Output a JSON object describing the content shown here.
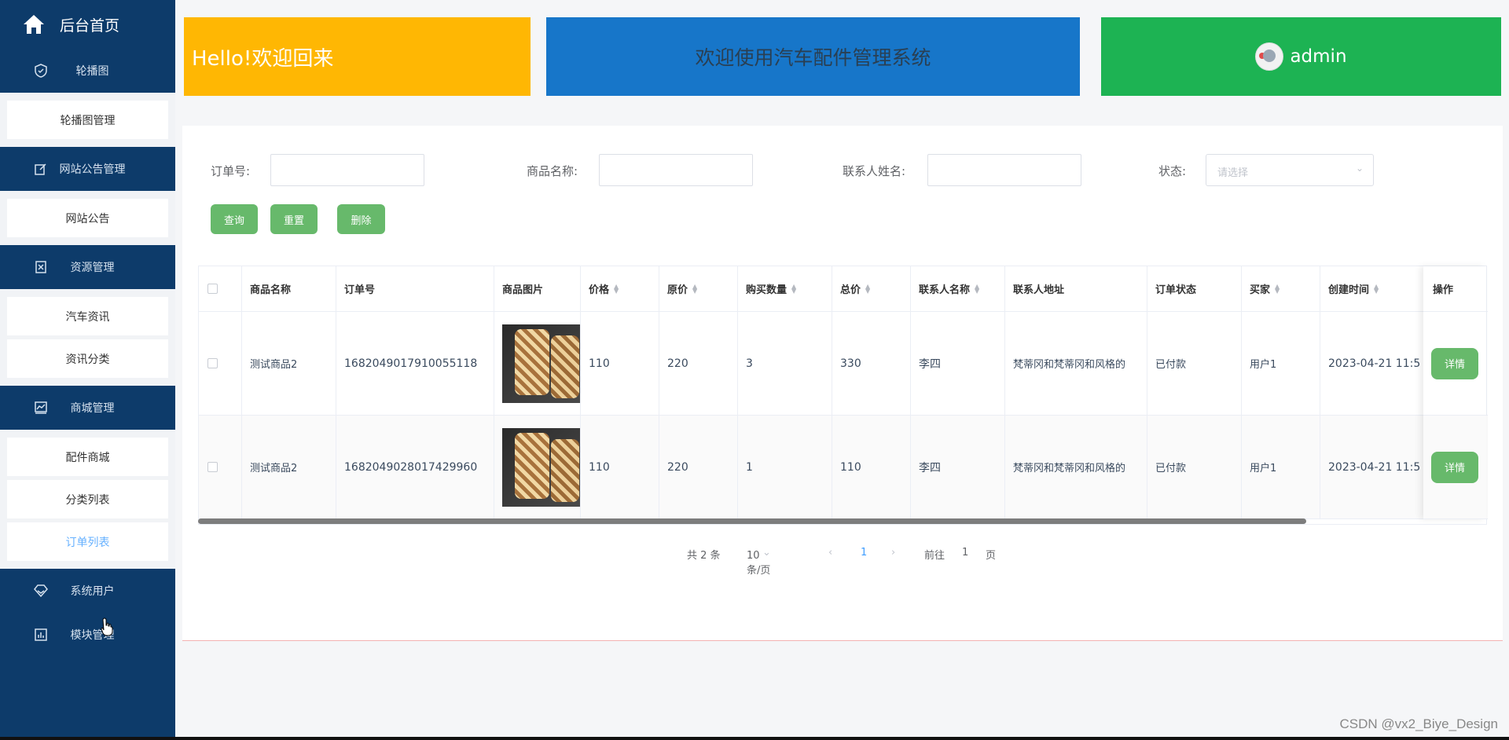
{
  "sidebar": {
    "home_label": "后台首页",
    "sections": [
      {
        "label": "轮播图",
        "icon": "shield-icon"
      },
      {
        "label": "网站公告管理",
        "icon": "edit-icon"
      },
      {
        "label": "资源管理",
        "icon": "resource-icon"
      },
      {
        "label": "商城管理",
        "icon": "chart-icon"
      },
      {
        "label": "系统用户",
        "icon": "diamond-icon"
      },
      {
        "label": "模块管理",
        "icon": "bar-chart-icon"
      }
    ],
    "subitems": {
      "carousel": [
        "轮播图管理"
      ],
      "notice": [
        "网站公告"
      ],
      "resource": [
        "汽车资讯",
        "资讯分类"
      ],
      "mall": [
        "配件商城",
        "分类列表",
        "订单列表"
      ]
    },
    "active_item": "订单列表"
  },
  "cards": {
    "welcome": "Hello!欢迎回来",
    "system": "欢迎使用汽车配件管理系统",
    "user": "admin"
  },
  "filters": {
    "order_no_label": "订单号:",
    "product_name_label": "商品名称:",
    "contact_name_label": "联系人姓名:",
    "status_label": "状态:",
    "status_placeholder": "请选择"
  },
  "buttons": {
    "query": "查询",
    "reset": "重置",
    "delete": "删除",
    "detail": "详情"
  },
  "table": {
    "columns": [
      "商品名称",
      "订单号",
      "商品图片",
      "价格",
      "原价",
      "购买数量",
      "总价",
      "联系人名称",
      "联系人地址",
      "订单状态",
      "买家",
      "创建时间",
      "操作"
    ],
    "rows": [
      {
        "name": "测试商品2",
        "order_no": "1682049017910055118",
        "price": "110",
        "original": "220",
        "qty": "3",
        "total": "330",
        "contact": "李四",
        "address": "梵蒂冈和梵蒂冈和风格的",
        "status": "已付款",
        "buyer": "用户1",
        "created": "2023-04-21 11:5"
      },
      {
        "name": "测试商品2",
        "order_no": "1682049028017429960",
        "price": "110",
        "original": "220",
        "qty": "1",
        "total": "110",
        "contact": "李四",
        "address": "梵蒂冈和梵蒂冈和风格的",
        "status": "已付款",
        "buyer": "用户1",
        "created": "2023-04-21 11:5"
      }
    ]
  },
  "pagination": {
    "total": "共 2 条",
    "page_size": "10条/页",
    "current_page": "1",
    "goto_label": "前往",
    "goto_value": "1",
    "page_suffix": "页"
  },
  "watermark": "CSDN @vx2_Biye_Design",
  "colors": {
    "sidebar": "#0d3b6a",
    "yellow_card": "#ffb703",
    "blue_card": "#1776c9",
    "green_card": "#1db353",
    "button_green": "#67b96b",
    "active_link": "#66b1ff"
  }
}
